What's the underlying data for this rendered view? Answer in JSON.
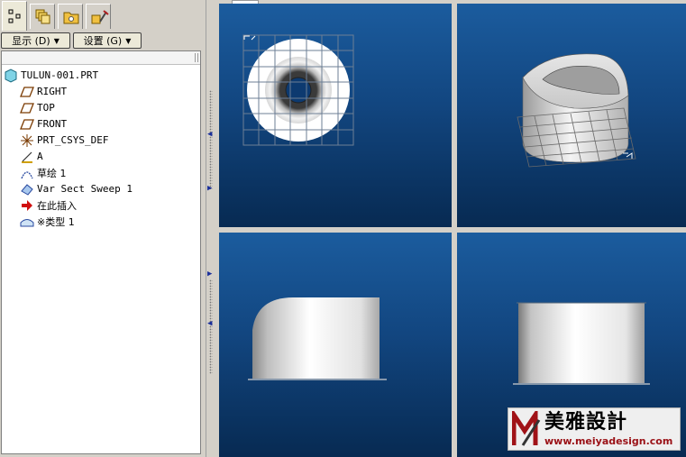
{
  "toolbar": {
    "show_menu": "显示 (D)",
    "settings_menu": "设置 (G)"
  },
  "tabs": [
    {
      "icon": "model-tree-icon",
      "active": true
    },
    {
      "icon": "layers-icon",
      "active": false
    },
    {
      "icon": "folder-icon",
      "active": false
    },
    {
      "icon": "tools-icon",
      "active": false
    }
  ],
  "model_tree": {
    "root": "TULUN-001.PRT",
    "items": [
      {
        "label": "RIGHT",
        "icon": "datum-plane-icon"
      },
      {
        "label": "TOP",
        "icon": "datum-plane-icon"
      },
      {
        "label": "FRONT",
        "icon": "datum-plane-icon"
      },
      {
        "label": "PRT_CSYS_DEF",
        "icon": "coordinate-system-icon"
      },
      {
        "label": "A",
        "icon": "datum-axis-icon"
      },
      {
        "label": "草绘 1",
        "icon": "sketch-icon"
      },
      {
        "label": "Var Sect Sweep 1",
        "icon": "sweep-feature-icon"
      },
      {
        "label": "在此插入",
        "icon": "insert-here-arrow-icon"
      },
      {
        "label": "※类型 1",
        "icon": "feature-type-icon"
      }
    ]
  },
  "viewports": [
    "top-view",
    "isometric-view",
    "front-view",
    "side-view"
  ],
  "watermark": {
    "brand_cn": "美雅設計",
    "url": "www.meiyadesign.com"
  },
  "colors": {
    "viewport_top": "#1b5c9e",
    "viewport_bottom": "#072a52",
    "panel_bg": "#d4d0c8",
    "watermark_red": "#9a1015"
  }
}
